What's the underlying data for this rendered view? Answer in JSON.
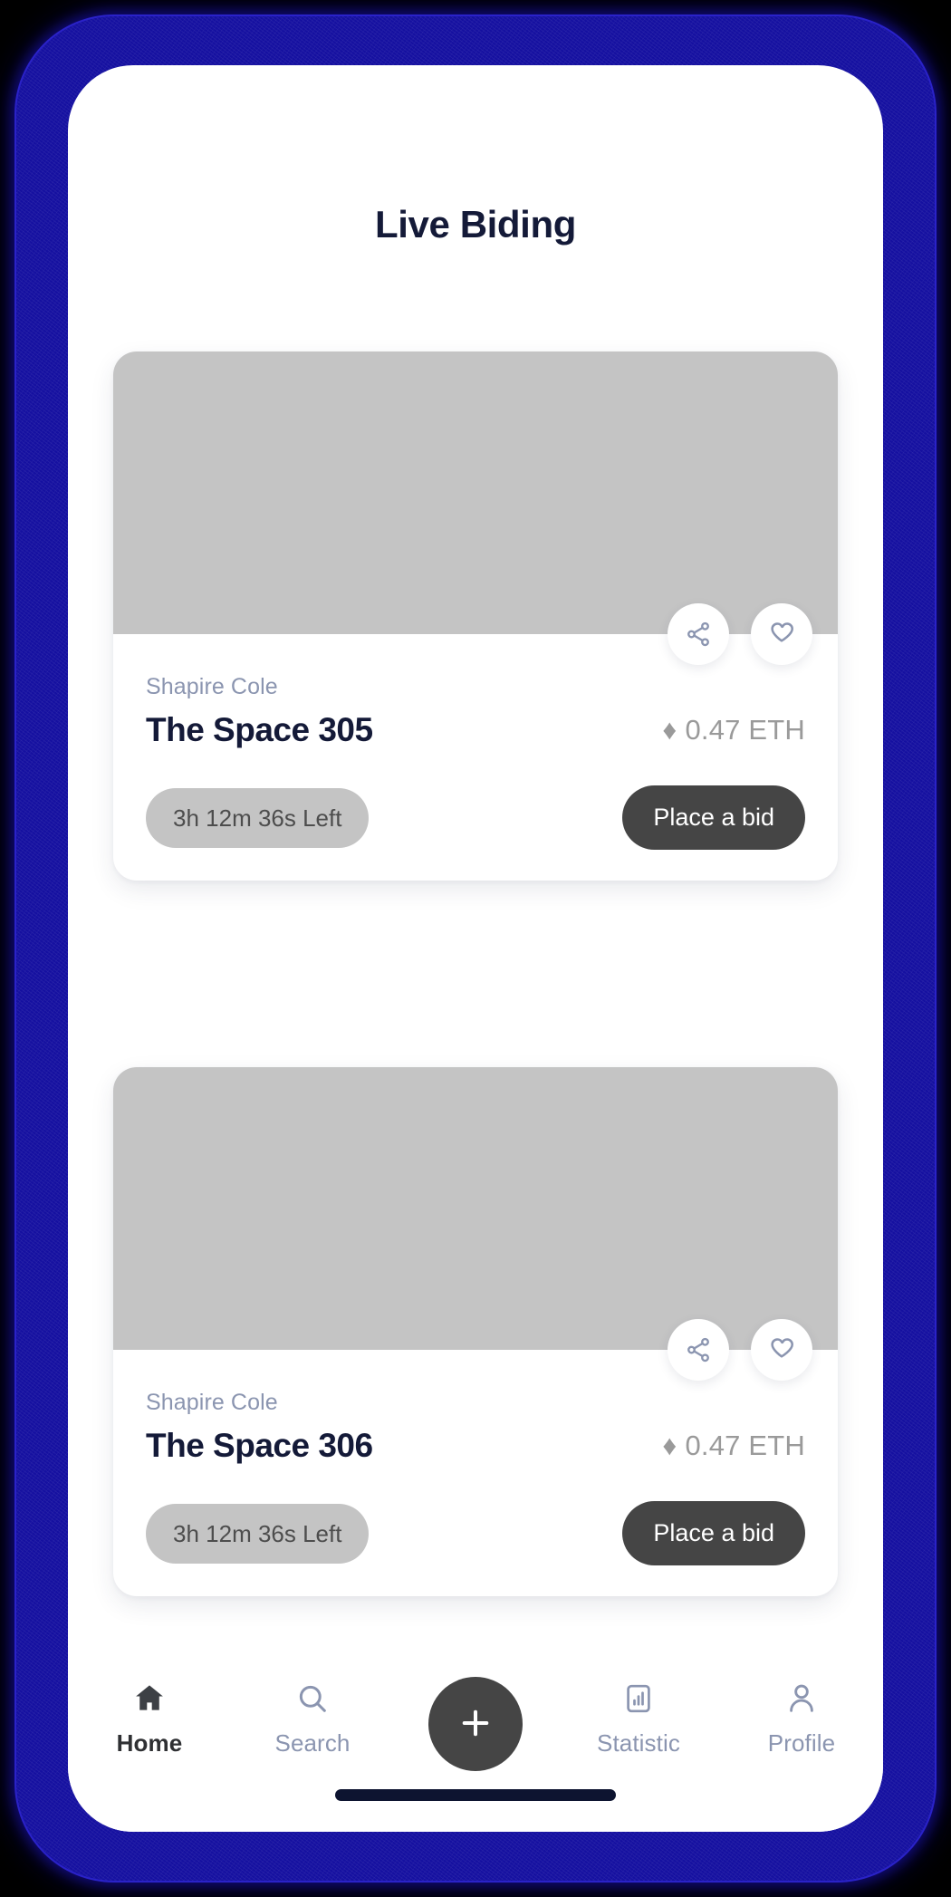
{
  "header": {
    "title": "Live Biding"
  },
  "colors": {
    "bezel": "#1510a0",
    "title_navy": "#141a38",
    "muted_slate": "#8b95b0",
    "placeholder_gray": "#c4c4c4",
    "dark_button": "#454545",
    "price_gray": "#9a9a9a",
    "home_indicator": "#0d1430"
  },
  "cards": [
    {
      "author": "Shapire Cole",
      "title": "The Space 305",
      "price": "0.47 ETH",
      "price_symbol": "♦",
      "timer": "3h 12m 36s Left",
      "bid_label": "Place a bid",
      "share_icon": "share-icon",
      "like_icon": "heart-icon"
    },
    {
      "author": "Shapire Cole",
      "title": "The Space 306",
      "price": "0.47 ETH",
      "price_symbol": "♦",
      "timer": "3h 12m 36s Left",
      "bid_label": "Place a bid",
      "share_icon": "share-icon",
      "like_icon": "heart-icon"
    }
  ],
  "bottom_nav": {
    "items": [
      {
        "label": "Home",
        "icon": "home-icon",
        "active": true
      },
      {
        "label": "Search",
        "icon": "search-icon",
        "active": false
      },
      {
        "label": "Statistic",
        "icon": "chart-icon",
        "active": false
      },
      {
        "label": "Profile",
        "icon": "person-icon",
        "active": false
      }
    ],
    "fab": {
      "icon": "plus-icon",
      "label": "+"
    }
  }
}
